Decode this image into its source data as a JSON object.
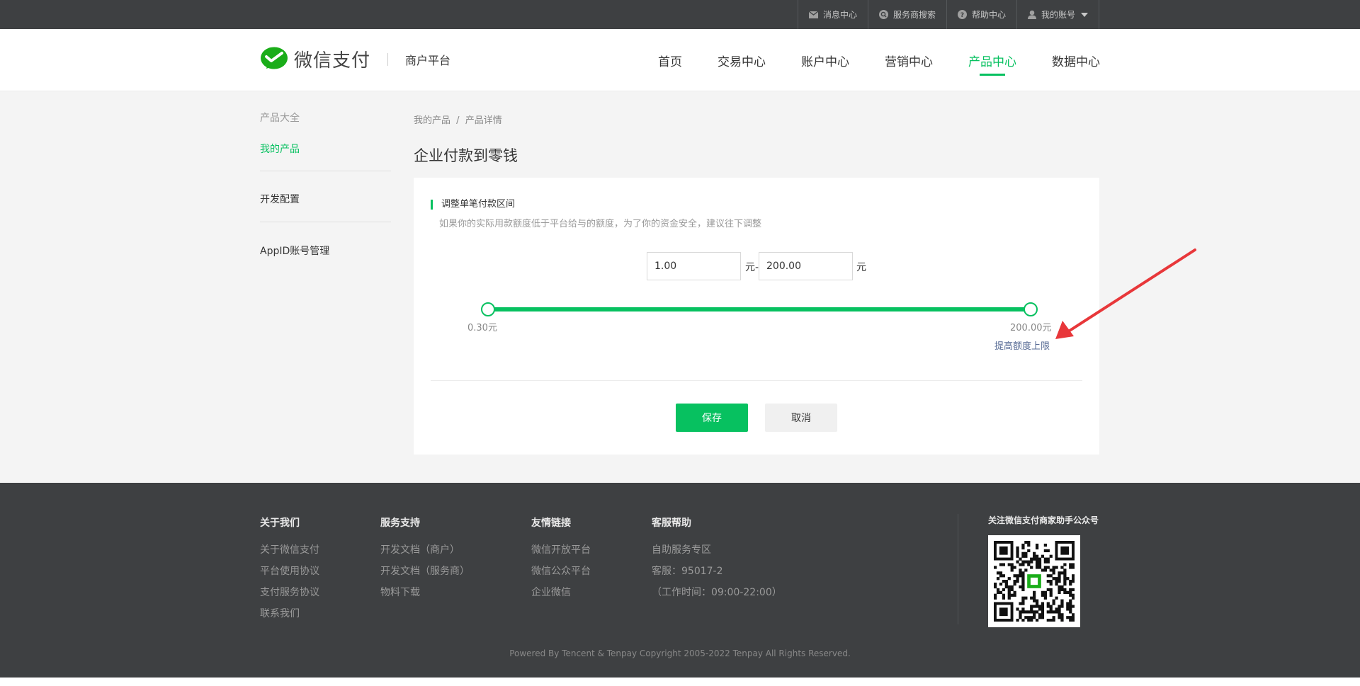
{
  "topbar": {
    "items": [
      {
        "label": "消息中心",
        "icon": "mail-icon"
      },
      {
        "label": "服务商搜索",
        "icon": "search-icon"
      },
      {
        "label": "帮助中心",
        "icon": "help-icon"
      },
      {
        "label": "我的账号",
        "icon": "user-icon"
      }
    ]
  },
  "header": {
    "logo_text": "微信支付",
    "subtitle": "商户平台",
    "nav": [
      {
        "label": "首页"
      },
      {
        "label": "交易中心"
      },
      {
        "label": "账户中心"
      },
      {
        "label": "营销中心"
      },
      {
        "label": "产品中心",
        "active": true
      },
      {
        "label": "数据中心"
      }
    ]
  },
  "sidebar": {
    "category": "产品大全",
    "active": "我的产品",
    "items": [
      {
        "label": "开发配置"
      },
      {
        "label": "AppID账号管理"
      }
    ]
  },
  "breadcrumb": {
    "items": [
      "我的产品",
      "产品详情"
    ],
    "separator": "/"
  },
  "page_title": "企业付款到零钱",
  "form": {
    "section_title": "调整单笔付款区间",
    "section_desc": "如果你的实际用款额度低于平台给与的额度，为了你的资金安全，建议往下调整",
    "min_value": "1.00",
    "max_value": "200.00",
    "unit": "元",
    "unit_dash": "元-",
    "range_min_label": "0.30元",
    "range_max_label": "200.00元",
    "raise_limit_link": "提高额度上限",
    "save_label": "保存",
    "cancel_label": "取消"
  },
  "footer": {
    "columns": [
      {
        "title": "关于我们",
        "links": [
          "关于微信支付",
          "平台使用协议",
          "支付服务协议",
          "联系我们"
        ]
      },
      {
        "title": "服务支持",
        "links": [
          "开发文档（商户）",
          "开发文档（服务商）",
          "物料下载"
        ]
      },
      {
        "title": "友情链接",
        "links": [
          "微信开放平台",
          "微信公众平台",
          "企业微信"
        ]
      },
      {
        "title": "客服帮助",
        "links": [
          "自助服务专区",
          "客服：95017-2",
          "（工作时间：09:00-22:00）"
        ]
      }
    ],
    "qr_title": "关注微信支付商家助手公众号",
    "copyright": "Powered By Tencent & Tenpay    Copyright 2005-2022 Tenpay All Rights Reserved."
  },
  "colors": {
    "accent": "#07c160",
    "topbar_bg": "#3e4042",
    "footer_bg": "#3e4042",
    "link": "#576b95",
    "annotation_arrow": "#e8373a"
  }
}
